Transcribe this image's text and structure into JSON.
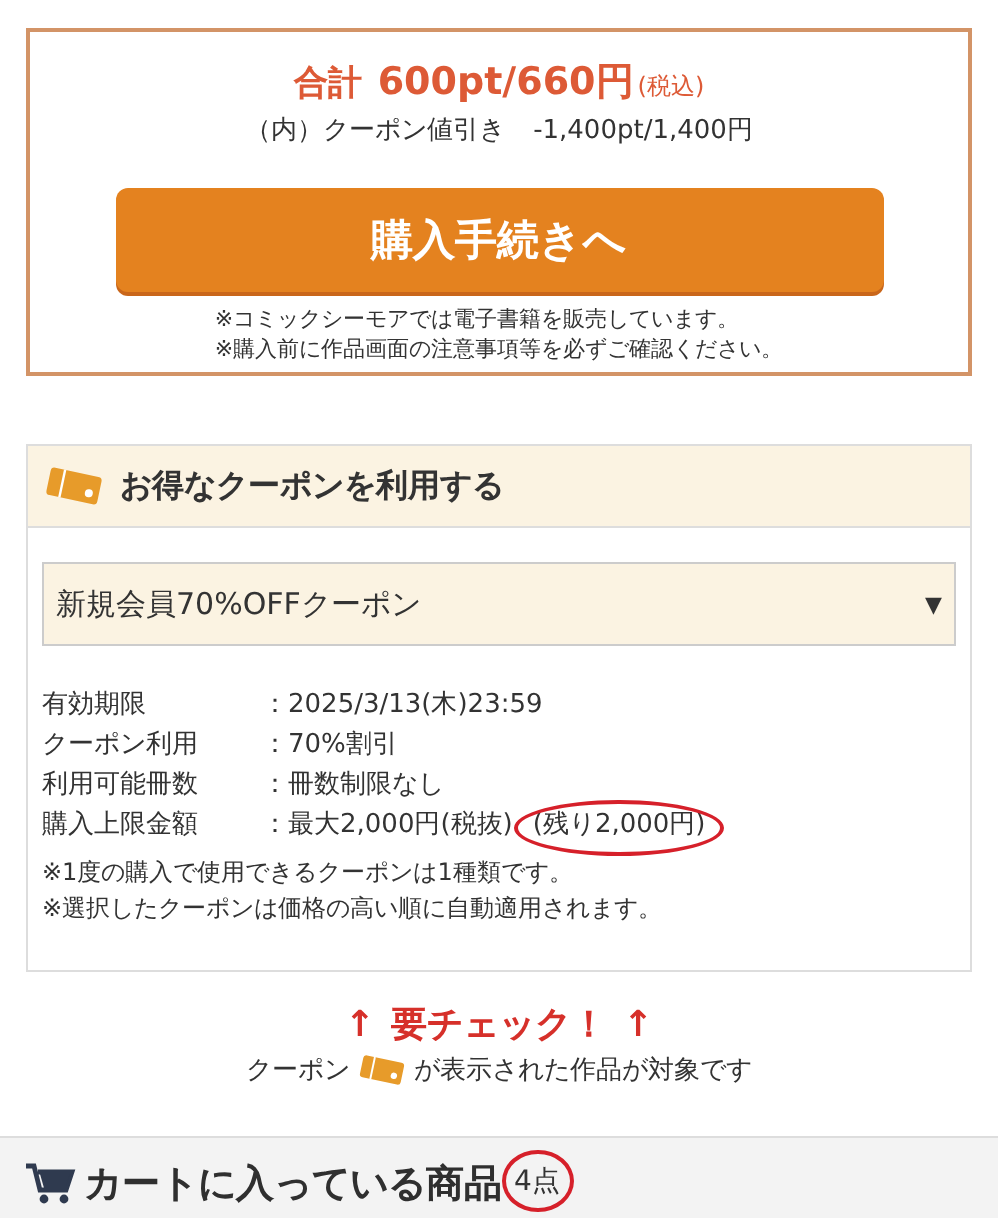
{
  "total": {
    "label": "合計",
    "amount": "600pt/660円",
    "tax": "(税込)"
  },
  "discount": {
    "label": "（内）クーポン値引き",
    "amount": "-1,400pt/1,400円"
  },
  "checkout_button": "購入手続きへ",
  "notices": [
    "※コミックシーモアでは電子書籍を販売しています。",
    "※購入前に作品画面の注意事項等を必ずご確認ください。"
  ],
  "coupon": {
    "title": "お得なクーポンを利用する",
    "select": {
      "value": "新規会員70%OFFクーポン",
      "arrow": "▼"
    },
    "details": [
      {
        "label": "有効期限",
        "value": "：2025/3/13(木)23:59"
      },
      {
        "label": "クーポン利用",
        "value": "：70%割引"
      },
      {
        "label": "利用可能冊数",
        "value": "：冊数制限なし"
      },
      {
        "label": "購入上限金額",
        "value": "：最大2,000円(税抜)",
        "extra": "(残り2,000円)",
        "circled": true
      }
    ],
    "notes": [
      "※1度の購入で使用できるクーポンは1種類です。",
      "※選択したクーポンは価格の高い順に自動適用されます。"
    ]
  },
  "check": {
    "arrow_left": "↑",
    "title": "要チェック！",
    "arrow_right": "↑",
    "note_before": "クーポン",
    "note_after": "が表示された作品が対象です"
  },
  "cart": {
    "title": "カートに入っている商品",
    "count": "4点",
    "circled": true
  }
}
